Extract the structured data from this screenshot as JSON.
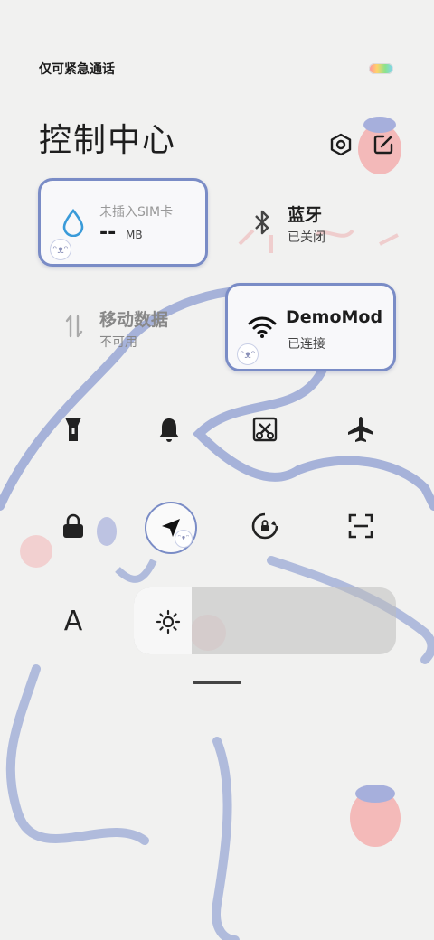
{
  "status": {
    "carrier_text": "仅可紧急通话"
  },
  "header": {
    "title": "控制中心"
  },
  "icons": {
    "settings": "hexagon-settings-icon",
    "edit": "edit-icon"
  },
  "cards": {
    "data": {
      "title": "未插入SIM卡",
      "value": "--",
      "unit": "MB"
    },
    "bluetooth": {
      "title": "蓝牙",
      "status": "已关闭"
    },
    "mobile_data": {
      "title": "移动数据",
      "status": "不可用"
    },
    "wifi": {
      "title": "DemoMod",
      "status": "已连接"
    }
  },
  "toggles": {
    "row1": [
      "flashlight-icon",
      "bell-icon",
      "screenshot-cut-icon",
      "airplane-icon"
    ],
    "row2": [
      "lock-icon",
      "location-arrow-icon",
      "rotation-lock-icon",
      "scan-icon"
    ],
    "row3_left": "A"
  },
  "brightness": {
    "level": 0.22
  },
  "colors": {
    "accent_border": "#7a8cc6",
    "wifi_active": "#7a8cc6"
  }
}
